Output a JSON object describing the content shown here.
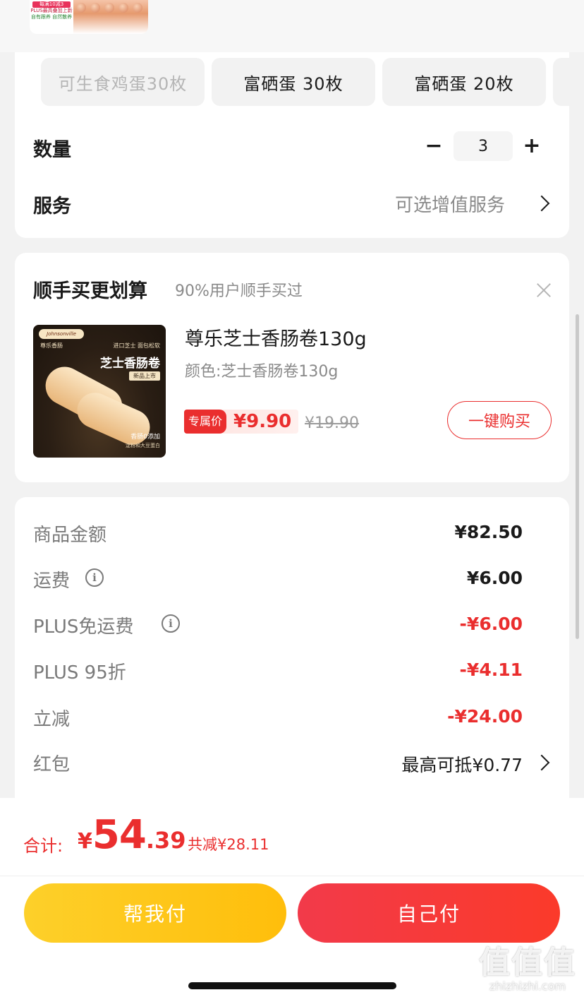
{
  "thumbnail": {
    "promo_line1": "每满10减3",
    "promo_line2": "PLUS最高叠加上新",
    "promo_line3": "自有跟养 自然散养"
  },
  "variants": [
    {
      "label": "可生食鸡蛋30枚",
      "disabled": true
    },
    {
      "label": "富硒蛋 30枚",
      "disabled": false
    },
    {
      "label": "富硒蛋 20枚",
      "disabled": false
    }
  ],
  "quantity": {
    "label": "数量",
    "value": "3",
    "minus": "−",
    "plus": "+"
  },
  "service": {
    "label": "服务",
    "value": "可选增值服务"
  },
  "addon": {
    "title": "顺手买更划算",
    "subtitle": "90%用户顺手买过",
    "product_name": "尊乐芝士香肠卷130g",
    "product_spec": "颜色:芝士香肠卷130g",
    "price_label": "专属价",
    "price": "¥9.90",
    "original_price": "¥19.90",
    "buy_label": "一键购买",
    "image": {
      "brand": "Johnsonville",
      "brand_cn": "尊乐香肠",
      "sub": "进口芝士 面包松软",
      "name": "芝士香肠卷",
      "badge": "新品上市",
      "footnote": "香肠0添加",
      "footnote2": "淀粉和大豆蛋白"
    }
  },
  "summary": [
    {
      "label": "商品金额",
      "value": "¥82.50",
      "info": false,
      "red": false
    },
    {
      "label": "运费",
      "value": "¥6.00",
      "info": true,
      "red": false
    },
    {
      "label": "PLUS免运费",
      "value": "-¥6.00",
      "info": true,
      "red": true
    },
    {
      "label": "PLUS 95折",
      "value": "-¥4.11",
      "info": false,
      "red": true
    },
    {
      "label": "立减",
      "value": "-¥24.00",
      "info": false,
      "red": true
    },
    {
      "label": "红包",
      "value": "最高可抵¥0.77",
      "info": false,
      "red": false
    }
  ],
  "total": {
    "label": "合计:",
    "currency": "¥",
    "integer": "54",
    "decimal": ".39",
    "saved": "共减¥28.11"
  },
  "buttons": {
    "help_pay": "帮我付",
    "self_pay": "自己付"
  },
  "watermark": {
    "big": "值值值",
    "small": "zhizhizhi.com"
  },
  "colors": {
    "accent": "#ea2e2e",
    "help_btn": "#ffc414",
    "self_btn": "#f5333c"
  }
}
